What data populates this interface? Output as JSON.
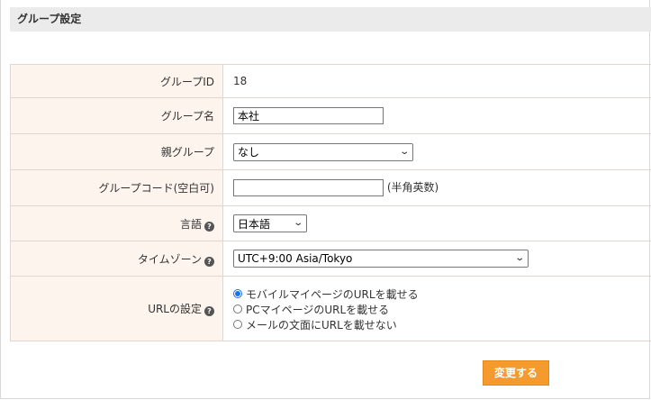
{
  "header": {
    "title": "グループ設定"
  },
  "form": {
    "group_id": {
      "label": "グループID",
      "value": "18"
    },
    "group_name": {
      "label": "グループ名",
      "value": "本社"
    },
    "parent_group": {
      "label": "親グループ",
      "value": "なし"
    },
    "group_code": {
      "label": "グループコード(空白可)",
      "value": "",
      "hint": "(半角英数)"
    },
    "language": {
      "label": "言語",
      "value": "日本語"
    },
    "timezone": {
      "label": "タイムゾーン",
      "value": "UTC+9:00 Asia/Tokyo"
    },
    "url_setting": {
      "label": "URLの設定",
      "options": [
        {
          "label": "モバイルマイページのURLを載せる",
          "selected": true
        },
        {
          "label": "PCマイページのURLを載せる",
          "selected": false
        },
        {
          "label": "メールの文面にURLを載せない",
          "selected": false
        }
      ]
    }
  },
  "submit_label": "変更する",
  "colors": {
    "accent": "#f59a2c",
    "label_bg": "#fdf4ee",
    "header_bg": "#ebebeb"
  }
}
